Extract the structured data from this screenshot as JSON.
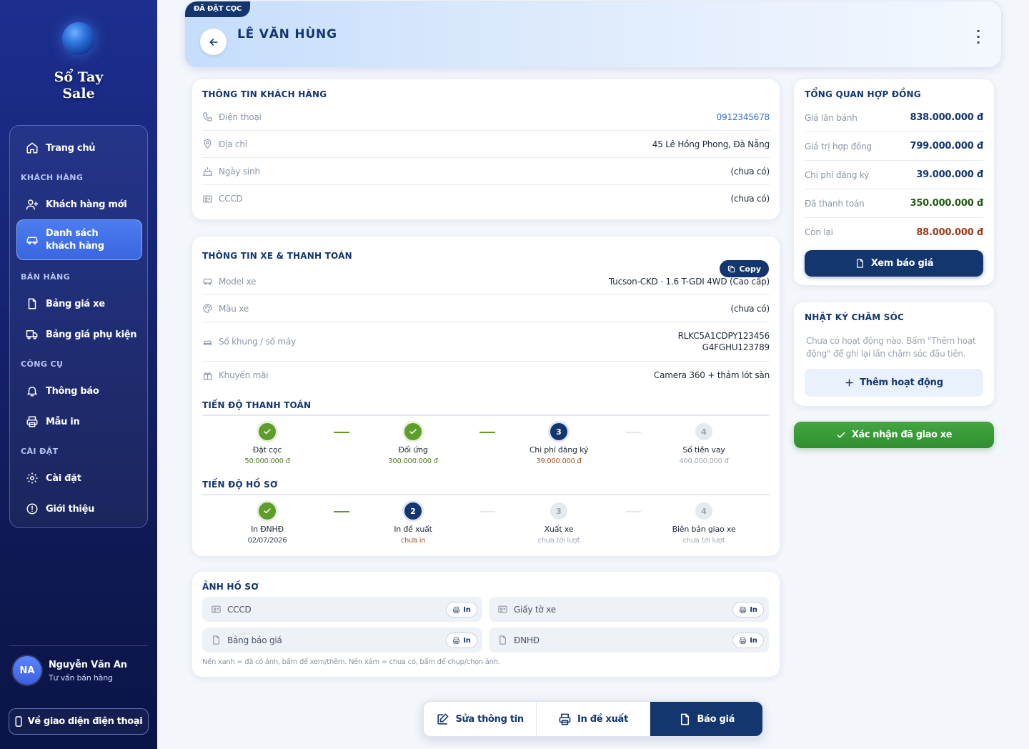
{
  "app": {
    "title_line1": "Sổ Tay",
    "title_line2": "Sale"
  },
  "nav": {
    "home": "Trang chủ",
    "sec_customers": "KHÁCH HÀNG",
    "new_customer": "Khách hàng mới",
    "customer_list": "Danh sách khách hàng",
    "sec_sales": "BÁN HÀNG",
    "price_list": "Bảng giá xe",
    "accessory_price": "Bảng giá phụ kiện",
    "sec_tools": "CÔNG CỤ",
    "notifications": "Thông báo",
    "templates": "Mẫu in",
    "sec_settings": "CÀI ĐẶT",
    "settings": "Cài đặt",
    "about": "Giới thiệu"
  },
  "user": {
    "initials": "NA",
    "name": "Nguyễn Văn An",
    "role": "Tư vấn bán hàng"
  },
  "mobile_button": "Về giao diện điện thoại",
  "header": {
    "status": "ĐÃ ĐẶT CỌC",
    "customer_name": "LÊ VĂN HÙNG",
    "more": "⋮"
  },
  "customer_info": {
    "title": "THÔNG TIN KHÁCH HÀNG",
    "rows": [
      {
        "label": "Điện thoại",
        "value": "0912345678",
        "icon": "phone-icon"
      },
      {
        "label": "Địa chỉ",
        "value": "45 Lê Hồng Phong, Đà Nẵng",
        "icon": "map-pin-icon"
      },
      {
        "label": "Ngày sinh",
        "value": "(chưa có)",
        "icon": "cake-icon"
      },
      {
        "label": "CCCD",
        "value": "(chưa có)",
        "icon": "id-card-icon"
      }
    ]
  },
  "vehicle_info": {
    "title": "THÔNG TIN XE & THANH TOÁN",
    "copy_label": "Copy",
    "rows": [
      {
        "label": "Model xe",
        "value": "Tucson-CKD · 1.6 T-GDI 4WD (Cao cấp)",
        "icon": "car-icon"
      },
      {
        "label": "Màu xe",
        "value": "(chưa có)",
        "icon": "palette-icon"
      },
      {
        "label": "Số khung / số máy",
        "value": "RLKC5A1CDPY123456",
        "value2": "G4FGHU123789",
        "icon": "car-front-icon"
      },
      {
        "label": "Khuyến mãi",
        "value": "Camera 360 + thảm lót sàn",
        "icon": "gift-icon"
      }
    ]
  },
  "payment_progress": {
    "title": "TIẾN ĐỘ THANH TOÁN",
    "steps": [
      {
        "name": "Đặt cọc",
        "sub": "50.000.000 đ",
        "state": "done",
        "num": "✓"
      },
      {
        "name": "Đối ứng",
        "sub": "300.000.000 đ",
        "state": "done",
        "num": "✓"
      },
      {
        "name": "Chi phí đăng ký",
        "sub": "39.000.000 đ",
        "state": "current",
        "num": "3"
      },
      {
        "name": "Số tiền vay",
        "sub": "400.000.000 đ",
        "state": "todo",
        "num": "4"
      }
    ]
  },
  "document_progress": {
    "title": "TIẾN ĐỘ HỒ SƠ",
    "steps": [
      {
        "name": "In ĐNHĐ",
        "sub": "02/07/2026",
        "state": "done",
        "num": "✓"
      },
      {
        "name": "In đề xuất",
        "sub": "chưa in",
        "state": "current",
        "num": "2"
      },
      {
        "name": "Xuất xe",
        "sub": "chưa tới lượt",
        "state": "todo",
        "num": "3"
      },
      {
        "name": "Biên bản giao xe",
        "sub": "chưa tới lượt",
        "state": "todo",
        "num": "4"
      }
    ]
  },
  "photos": {
    "title": "ẢNH HỒ SƠ",
    "items": [
      {
        "label": "CCCD",
        "icon": "id-card-icon"
      },
      {
        "label": "Giấy tờ xe",
        "icon": "id-card-icon"
      },
      {
        "label": "Bảng báo giá",
        "icon": "file-icon"
      },
      {
        "label": "ĐNHĐ",
        "icon": "file-icon"
      }
    ],
    "print_label": "In",
    "note": "Nền xanh = đã có ảnh, bấm để xem/thêm. Nền xám = chưa có, bấm để chụp/chọn ảnh."
  },
  "contract_summary": {
    "title": "TỔNG QUAN HỢP ĐỒNG",
    "rows": [
      {
        "label": "Giá lăn bánh",
        "value": "838.000.000 đ",
        "color": "#13366e"
      },
      {
        "label": "Giá trị hợp đồng",
        "value": "799.000.000 đ",
        "color": "#13366e"
      },
      {
        "label": "Chi phí đăng ký",
        "value": "39.000.000 đ",
        "color": "#13366e"
      },
      {
        "label": "Đã thanh toán",
        "value": "350.000.000 đ",
        "color": "#1f5a12"
      },
      {
        "label": "Còn lại",
        "value": "88.000.000 đ",
        "color": "#a03a1a"
      }
    ],
    "quote_button": "Xem báo giá"
  },
  "care_log": {
    "title": "NHẬT KÝ CHĂM SÓC",
    "empty": "Chưa có hoạt động nào. Bấm \"Thêm hoạt động\" để ghi lại lần chăm sóc đầu tiên.",
    "add_button": "Thêm hoạt động"
  },
  "confirm_delivery": "Xác nhận đã giao xe",
  "bottom_bar": {
    "edit": "Sửa thông tin",
    "print_proposal": "In đề xuất",
    "quote": "Báo giá"
  },
  "colors": {
    "primary": "#13366e",
    "success": "#5e9d2a",
    "sidebar": "#162575",
    "accent": "#2f6fd6"
  }
}
